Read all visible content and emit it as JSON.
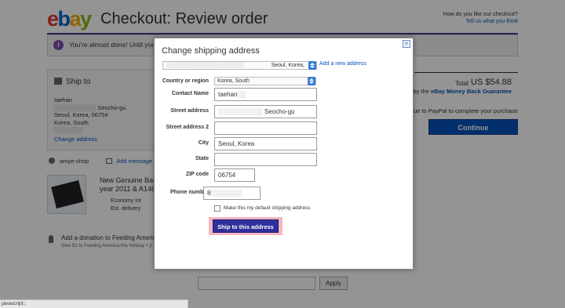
{
  "header": {
    "logo": {
      "e": "e",
      "b": "b",
      "a": "a",
      "y": "y"
    },
    "title": "Checkout: Review order",
    "feedback_line1": "How do you like our checkout?",
    "feedback_line2": "Tell us what you think"
  },
  "notice": {
    "icon": "info-icon",
    "text": "You're almost done! Until you c"
  },
  "ship_to": {
    "title": "Ship to",
    "name": "taehan",
    "street_suffix": "Seocho-gu",
    "city_line": "Seoul, Korea, 06754",
    "country": "Korea, South",
    "change_link": "Change address"
  },
  "seller": {
    "name": "amye-shop",
    "message_link": "Add message"
  },
  "item": {
    "title_line1": "New Genuine Batte",
    "title_line2": "year 2011 & A1466",
    "shipping": "Economy Int",
    "delivery": "Est. delivery"
  },
  "donation": {
    "title": "Add a donation to Feeding America",
    "subtitle": "Give $1 to Feeding America this holiday + p"
  },
  "summary": {
    "total_label": "Total",
    "total_value": "US $54.88",
    "guarantee_prefix": "ed by the ",
    "guarantee_link": "eBay Money Back Guarantee",
    "paypal_note": "ntinue to PayPal to complete your purchase",
    "continue_label": "Continue"
  },
  "coupon": {
    "apply_label": "Apply"
  },
  "statusbar": {
    "text": "javascript:;"
  },
  "modal": {
    "title": "Change shipping address",
    "close_icon": "close-icon",
    "saved_address_value": "Seoul, Korea,",
    "add_new_link": "Add a new address",
    "fields": {
      "country_label": "Country or region",
      "country_value": "Korea, South",
      "contact_label": "Contact Name",
      "contact_value": "taehan",
      "street_label": "Street address",
      "street_value": "Seocho-gu",
      "street2_label": "Street address 2",
      "street2_value": "",
      "city_label": "City",
      "city_value": "Seoul, Korea",
      "state_label": "State",
      "state_value": "",
      "zip_label": "ZIP code",
      "zip_value": "06754",
      "phone_label": "Phone number",
      "phone_value": "8"
    },
    "default_checkbox_label": "Make this my default shipping address",
    "ship_button_label": "Ship to this address"
  },
  "colors": {
    "ebay_red": "#e53238",
    "ebay_blue": "#0064d2",
    "ebay_yellow": "#f5af02",
    "ebay_green": "#86b817",
    "link_blue": "#0654ba",
    "ship_button": "#30309c",
    "highlight": "#f4b6c2"
  }
}
